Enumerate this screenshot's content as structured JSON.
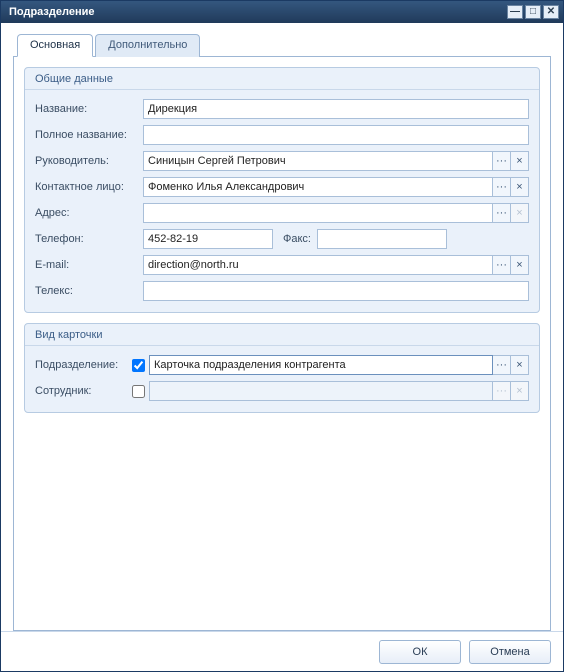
{
  "window": {
    "title": "Подразделение"
  },
  "tabs": {
    "main": "Основная",
    "extra": "Дополнительно"
  },
  "groups": {
    "general": "Общие данные",
    "cardtype": "Вид карточки"
  },
  "labels": {
    "name": "Название:",
    "fullname": "Полное название:",
    "head": "Руководитель:",
    "contact": "Контактное лицо:",
    "address": "Адрес:",
    "phone": "Телефон:",
    "fax": "Факс:",
    "email": "E-mail:",
    "telex": "Телекс:",
    "dept": "Подразделение:",
    "employee": "Сотрудник:"
  },
  "values": {
    "name": "Дирекция",
    "fullname": "",
    "head": "Синицын Сергей Петрович",
    "contact": "Фоменко Илья Александрович",
    "address": "",
    "phone": "452-82-19",
    "fax": "",
    "email": "direction@north.ru",
    "telex": "",
    "dept_checked": true,
    "dept": "Карточка подразделения контрагента",
    "employee_checked": false,
    "employee": ""
  },
  "icons": {
    "ellipsis": "···",
    "clear": "×",
    "minimize": "—",
    "maximize": "□",
    "close": "✕"
  },
  "buttons": {
    "ok": "ОК",
    "cancel": "Отмена"
  }
}
